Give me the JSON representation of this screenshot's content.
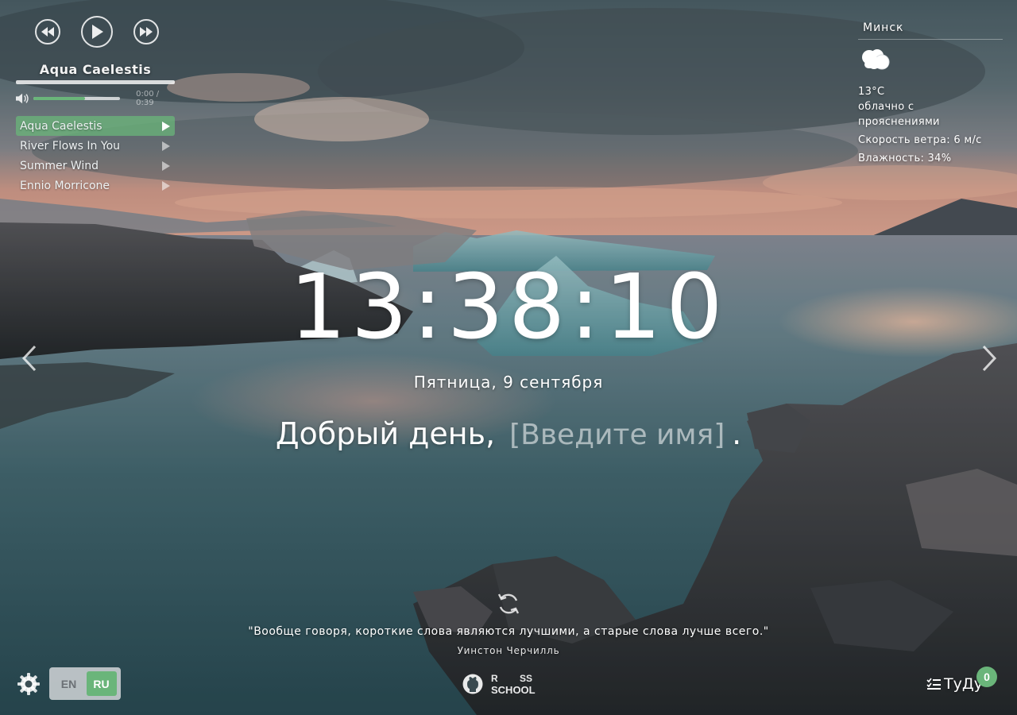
{
  "player": {
    "current_track": "Aqua Caelestis",
    "time": "0:00 / 0:39",
    "volume_fraction": 0.6,
    "progress_fraction": 0.0,
    "tracks": [
      {
        "title": "Aqua Caelestis",
        "active": true
      },
      {
        "title": "River Flows In You",
        "active": false
      },
      {
        "title": "Summer Wind",
        "active": false
      },
      {
        "title": "Ennio Morricone",
        "active": false
      }
    ],
    "icons": [
      "rewind-icon",
      "play-icon",
      "fast-forward-icon",
      "volume-icon"
    ]
  },
  "weather": {
    "city": "Минск",
    "icon": "cloudy-icon",
    "temperature": "13°C",
    "description": "облачно с прояснениями",
    "wind": "Скорость ветра: 6 м/с",
    "humidity": "Влажность: 34%"
  },
  "clock": {
    "time": "13:38:10",
    "date": "Пятница, 9 сентября"
  },
  "greeting": {
    "text": "Добрый день,",
    "name_placeholder": "[Введите имя]",
    "suffix": "."
  },
  "quote": {
    "text": "\"Вообще говоря, короткие слова являются лучшими, а старые слова лучше всего.\"",
    "author": "Уинстон Черчилль"
  },
  "footer": {
    "languages": [
      "EN",
      "RU"
    ],
    "active_language": "RU",
    "school_logo_lines": [
      "R",
      "SS",
      "SCHOOL"
    ],
    "todo_label": "ТуДу",
    "todo_count": "0"
  },
  "colors": {
    "accent": "#6ab57a",
    "lang_panel": "#d2d6d8"
  }
}
